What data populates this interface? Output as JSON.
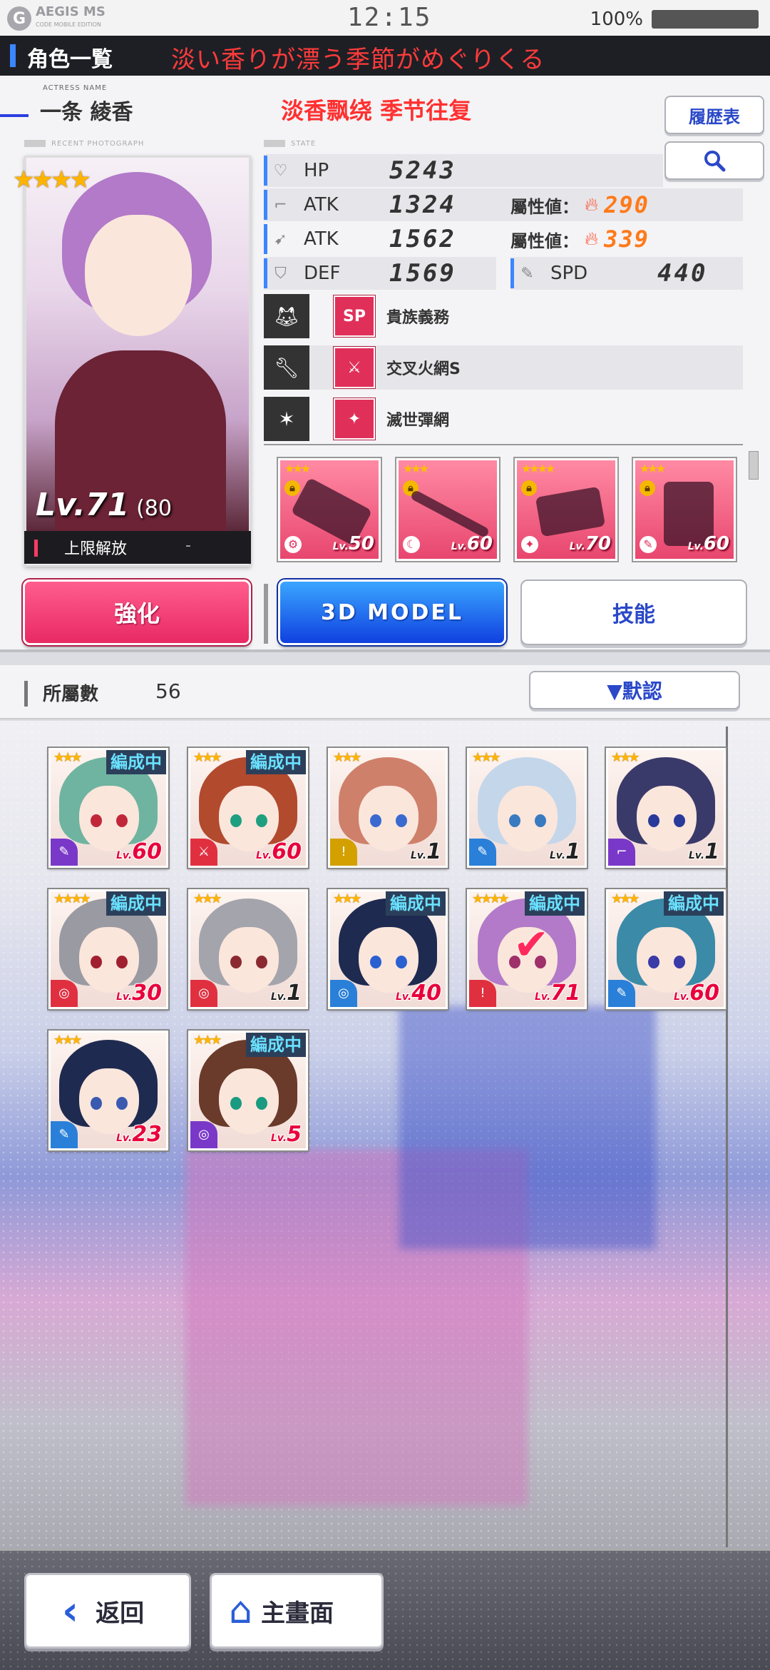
{
  "status": {
    "app_name": "AEGIS MS",
    "app_sub": "CODE MOBILE EDITION",
    "time": "12:15",
    "battery": "100%"
  },
  "header": {
    "title": "角色一覧",
    "overlay_jp": "淡い香りが漂う季節がめぐりくる",
    "overlay_cn": "淡香飘绕 季节往复"
  },
  "character": {
    "name_label": "ACTRESS NAME",
    "name": "一条 綾香",
    "photo_label": "RECENT PHOTOGRAPH",
    "state_label": "STATE",
    "stars": "★★★★",
    "level_prefix": "Lv.",
    "level": "71",
    "level_max": "(80",
    "limit_label": "上限解放",
    "limit_value": "-"
  },
  "buttons": {
    "history": "履歴表",
    "search_icon": "search-icon",
    "enhance": "強化",
    "model": "3D MODEL",
    "skill": "技能",
    "sort": "▼默認",
    "back": "返回",
    "home": "主畫面"
  },
  "stats": [
    {
      "icon": "heart-icon",
      "glyph": "♡",
      "label": "HP",
      "value": "5243"
    },
    {
      "icon": "gun-icon",
      "glyph": "⌐",
      "label": "ATK",
      "value": "1324",
      "attr_label": "屬性値：",
      "attr_value": "290"
    },
    {
      "icon": "cursor-icon",
      "glyph": "➹",
      "label": "ATK",
      "value": "1562",
      "attr_label": "屬性値：",
      "attr_value": "339"
    },
    {
      "icon": "shield-icon",
      "glyph": "⛉",
      "label": "DEF",
      "value": "1569"
    },
    {
      "icon": "feather-icon",
      "glyph": "✎",
      "label": "SPD",
      "value": "440"
    }
  ],
  "skills": [
    {
      "icon": "fox-icon",
      "badge": "SP",
      "name": "貴族義務"
    },
    {
      "icon": "wrench-icon",
      "badge": "⚔",
      "name": "交叉火網S"
    },
    {
      "icon": "burst-icon",
      "badge": "✦",
      "name": "滅世彈網"
    }
  ],
  "gear": [
    {
      "stars": "★★★",
      "level": "50",
      "type": "pistol"
    },
    {
      "stars": "★★★",
      "level": "60",
      "type": "rifle"
    },
    {
      "stars": "★★★★",
      "level": "70",
      "type": "boots"
    },
    {
      "stars": "★★★",
      "level": "60",
      "type": "suit"
    }
  ],
  "list": {
    "count_label": "所屬數",
    "count": "56",
    "form_label": "編成中",
    "cards": [
      {
        "stars": "★★★",
        "form": true,
        "level": "60",
        "hair": "#6fb4a0",
        "eye": "#c0283a",
        "type_color": "#7a38c8",
        "type": "✎"
      },
      {
        "stars": "★★★",
        "form": true,
        "level": "60",
        "hair": "#b24a2e",
        "eye": "#1ea080",
        "type_color": "#e03040",
        "type": "⚔"
      },
      {
        "stars": "★★★",
        "form": false,
        "level": "1",
        "hair": "#cf806a",
        "eye": "#3a6ad0",
        "type_color": "#d4a000",
        "type": "!"
      },
      {
        "stars": "★★★",
        "form": false,
        "level": "1",
        "hair": "#c4d6ea",
        "eye": "#3a7ac0",
        "type_color": "#2a80d8",
        "type": "✎"
      },
      {
        "stars": "★★★",
        "form": false,
        "level": "1",
        "hair": "#3a3a6a",
        "eye": "#2a3a9a",
        "type_color": "#7a38c8",
        "type": "⌐"
      },
      {
        "stars": "★★★★",
        "form": true,
        "level": "30",
        "hair": "#9a9aa2",
        "eye": "#a02030",
        "type_color": "#e03040",
        "type": "◎"
      },
      {
        "stars": "★★★",
        "form": false,
        "level": "1",
        "hair": "#a4a4ac",
        "eye": "#8a2a30",
        "type_color": "#e03040",
        "type": "◎"
      },
      {
        "stars": "★★★",
        "form": true,
        "level": "40",
        "hair": "#1e2a50",
        "eye": "#2a60d0",
        "type_color": "#2a80d8",
        "type": "◎"
      },
      {
        "stars": "★★★★",
        "form": true,
        "level": "71",
        "hair": "#b27ac8",
        "eye": "#a0306a",
        "type_color": "#e03040",
        "type": "!",
        "check": "✔"
      },
      {
        "stars": "★★★",
        "form": true,
        "level": "60",
        "hair": "#3a8aa8",
        "eye": "#3a3aa8",
        "type_color": "#2a80d8",
        "type": "✎"
      },
      {
        "stars": "★★★",
        "form": false,
        "level": "23",
        "hair": "#1e2a50",
        "eye": "#3a5ab0",
        "type_color": "#2a80d8",
        "type": "✎"
      },
      {
        "stars": "★★★",
        "form": true,
        "level": "5",
        "hair": "#6a3a2a",
        "eye": "#1a9a80",
        "type_color": "#7a38c8",
        "type": "◎"
      }
    ]
  }
}
